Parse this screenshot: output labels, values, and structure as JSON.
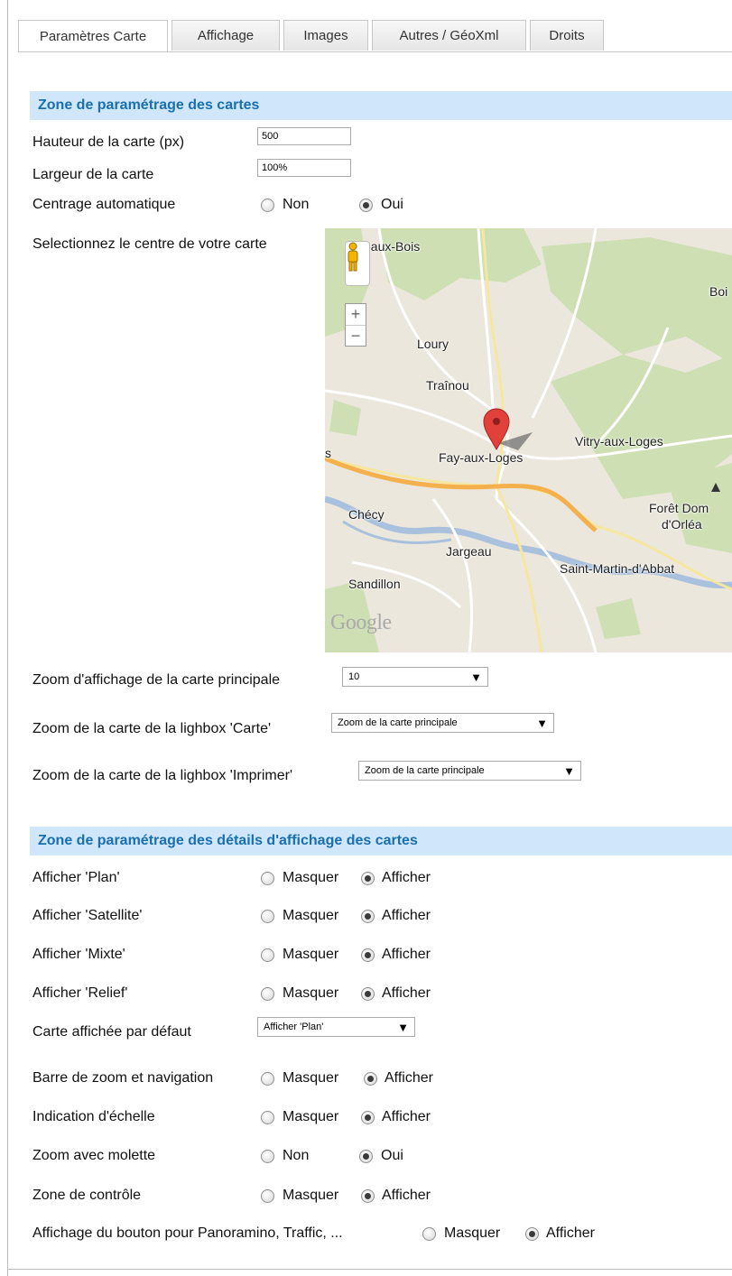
{
  "tabs": [
    "Paramètres Carte",
    "Affichage",
    "Images",
    "Autres / GéoXml",
    "Droits"
  ],
  "active_tab": "Paramètres Carte",
  "section1": {
    "title": "Zone de paramétrage des cartes",
    "height_label": "Hauteur de la carte (px)",
    "height_value": "500",
    "width_label": "Largeur de la carte",
    "width_value": "100%",
    "autocenter_label": "Centrage automatique",
    "autocenter_no": "Non",
    "autocenter_yes": "Oui",
    "autocenter_selected": "Oui",
    "select_center_label": "Selectionnez le centre de votre carte",
    "zoom_main_label": "Zoom d'affichage de la carte principale",
    "zoom_main_value": "10",
    "zoom_lightbox_label": "Zoom de la carte de la lighbox 'Carte'",
    "zoom_lightbox_value": "Zoom de la carte principale",
    "zoom_print_label": "Zoom de la carte de la lighbox 'Imprimer'",
    "zoom_print_value": "Zoom de la carte principale"
  },
  "map": {
    "places": [
      "ville-aux-Bois",
      "Boi",
      "Loury",
      "Traînou",
      "Vitry-aux-Loges",
      "Fay-aux-Loges",
      "Chécy",
      "Forêt Dom",
      "d'Orléa",
      "Jargeau",
      "Saint-Martin-d'Abbat",
      "Sandillon",
      "s"
    ],
    "zoom_in": "+",
    "zoom_out": "−",
    "logo": "Google",
    "colors": {
      "forest": "#cddfb3",
      "land": "#ece7dc",
      "road_main": "#f3b04d",
      "water": "#a9c1dc",
      "marker": "#e2403b"
    }
  },
  "section2": {
    "title": "Zone de paramétrage des détails d'affichage des cartes",
    "rows": [
      {
        "label": "Afficher 'Plan'",
        "off": "Masquer",
        "on": "Afficher",
        "selected": "on"
      },
      {
        "label": "Afficher 'Satellite'",
        "off": "Masquer",
        "on": "Afficher",
        "selected": "on"
      },
      {
        "label": "Afficher 'Mixte'",
        "off": "Masquer",
        "on": "Afficher",
        "selected": "on"
      },
      {
        "label": "Afficher 'Relief'",
        "off": "Masquer",
        "on": "Afficher",
        "selected": "on"
      }
    ],
    "default_map_label": "Carte affichée par défaut",
    "default_map_value": "Afficher 'Plan'",
    "rows2": [
      {
        "label": "Barre de zoom et navigation",
        "off": "Masquer",
        "on": "Afficher",
        "selected": "on"
      },
      {
        "label": "Indication d'échelle",
        "off": "Masquer",
        "on": "Afficher",
        "selected": "on"
      },
      {
        "label": "Zoom avec molette",
        "off": "Non",
        "on": "Oui",
        "selected": "on"
      },
      {
        "label": "Zone de contrôle",
        "off": "Masquer",
        "on": "Afficher",
        "selected": "on"
      },
      {
        "label": "Affichage du bouton pour Panoramino, Traffic, ...",
        "off": "Masquer",
        "on": "Afficher",
        "selected": "on"
      }
    ]
  },
  "arrow_glyph": "▼"
}
